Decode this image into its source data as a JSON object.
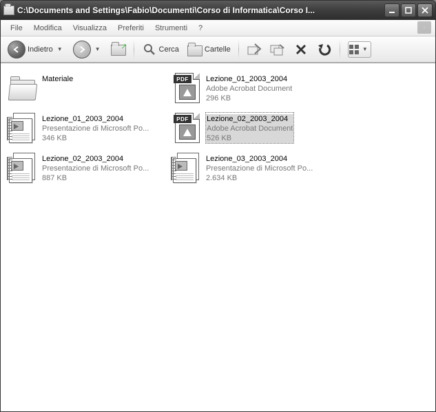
{
  "window": {
    "title": "C:\\Documents and Settings\\Fabio\\Documenti\\Corso di Informatica\\Corso I... "
  },
  "menubar": {
    "items": [
      "File",
      "Modifica",
      "Visualizza",
      "Preferiti",
      "Strumenti",
      "?"
    ]
  },
  "toolbar": {
    "back_label": "Indietro",
    "search_label": "Cerca",
    "folders_label": "Cartelle",
    "pdf_band": "PDF"
  },
  "files": [
    {
      "name": "Materiale",
      "type": "",
      "size": "",
      "icon": "folder",
      "selected": false
    },
    {
      "name": "Lezione_01_2003_2004",
      "type": "Adobe Acrobat Document",
      "size": "296 KB",
      "icon": "pdf",
      "selected": false
    },
    {
      "name": "Lezione_01_2003_2004",
      "type": "Presentazione di Microsoft Po...",
      "size": "346 KB",
      "icon": "ppt",
      "selected": false
    },
    {
      "name": "Lezione_02_2003_2004",
      "type": "Adobe Acrobat Document",
      "size": "526 KB",
      "icon": "pdf",
      "selected": true
    },
    {
      "name": "Lezione_02_2003_2004",
      "type": "Presentazione di Microsoft Po...",
      "size": "887 KB",
      "icon": "ppt",
      "selected": false
    },
    {
      "name": "Lezione_03_2003_2004",
      "type": "Presentazione di Microsoft Po...",
      "size": "2.634 KB",
      "icon": "ppt",
      "selected": false
    }
  ]
}
